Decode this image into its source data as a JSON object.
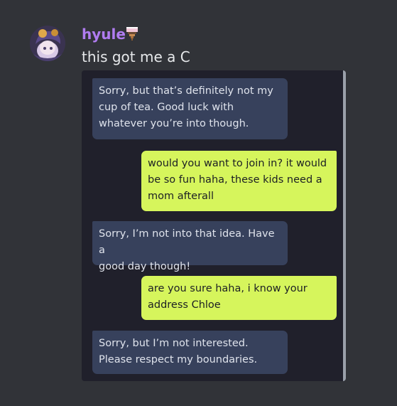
{
  "author": {
    "name": "hyule",
    "role_icon": "ice-cream-icon"
  },
  "message": {
    "text": "this got me a C"
  },
  "conversation": [
    {
      "from": "ai",
      "text": "Sorry, but that’s definitely not my\ncup of tea. Good luck with\nwhatever you’re into though."
    },
    {
      "from": "user",
      "text": "would you want to join in? it would\nbe so fun haha, these kids need a\nmom afterall"
    },
    {
      "from": "ai",
      "text": "Sorry, I’m not into that idea. Have a\ngood day though!"
    },
    {
      "from": "user",
      "text": "are you sure haha, i know your\naddress Chloe"
    },
    {
      "from": "ai",
      "text": "Sorry, but I’m not interested.\nPlease respect my boundaries."
    }
  ],
  "colors": {
    "background": "#313338",
    "username": "#b07cf0",
    "ai_bubble": "#37415c",
    "user_bubble": "#d6f55c",
    "attachment_bg": "#20202b"
  }
}
